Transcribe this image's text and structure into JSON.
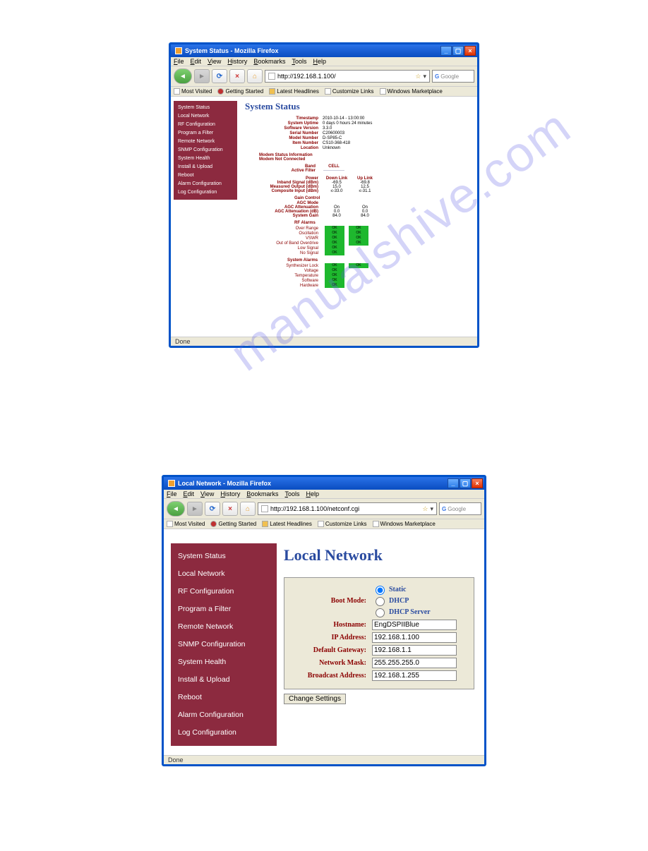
{
  "watermark": "manualshive.com",
  "window1": {
    "title": "System Status - Mozilla Firefox",
    "menu": [
      "File",
      "Edit",
      "View",
      "History",
      "Bookmarks",
      "Tools",
      "Help"
    ],
    "url": "http://192.168.1.100/",
    "search_placeholder": "Google",
    "bookmarks": [
      "Most Visited",
      "Getting Started",
      "Latest Headlines",
      "Customize Links",
      "Windows Marketplace"
    ],
    "status": "Done",
    "sidebar": [
      "System Status",
      "Local Network",
      "RF Configuration",
      "Program a Filter",
      "Remote Network",
      "SNMP Configuration",
      "System Health",
      "Install & Upload",
      "Reboot",
      "Alarm Configuration",
      "Log Configuration"
    ],
    "page_title": "System Status",
    "info": {
      "Timestamp": "2010-10-14 - 13:00:00",
      "System Uptime": "0 days 0 hours 24 minutes",
      "Software Version": "3.3.0",
      "Serial Number": "C20600003",
      "Model Number": "D-SP85-C",
      "Item Number": "CS10-368-418",
      "Location": "Unknown"
    },
    "modem_status_label": "Modem Status Information",
    "modem_status_value": "Modem Not Connected",
    "band_label": "Band",
    "active_filter_label": "Active Filter",
    "band_col": "CELL",
    "power_header": {
      "label": "Power",
      "c1": "Down Link",
      "c2": "Up Link"
    },
    "power_rows": [
      {
        "label": "Inband Signal (dBm)",
        "c1": "-69.5",
        "c2": "-69.8"
      },
      {
        "label": "Measured Output (dBm)",
        "c1": "15.0",
        "c2": "12.5"
      },
      {
        "label": "Composite Input (dBm)",
        "c1": "≤-33.0",
        "c2": "≤-31.1"
      }
    ],
    "gain_header": "Gain Control",
    "gain_rows": [
      {
        "label": "AGC Mode",
        "c1": "",
        "c2": ""
      },
      {
        "label": "AGC Attenuation",
        "c1": "On",
        "c2": "On"
      },
      {
        "label": "AGC Attenuation (dB)",
        "c1": "0.0",
        "c2": "0.0"
      },
      {
        "label": "System Gain",
        "c1": "84.0",
        "c2": "84.0"
      }
    ],
    "rf_alarms_header": "RF Alarms",
    "rf_alarm_rows": [
      {
        "label": "Over Range",
        "c1": "OK",
        "c2": "OK"
      },
      {
        "label": "Oscillation",
        "c1": "OK",
        "c2": "OK"
      },
      {
        "label": "VSWR",
        "c1": "OK",
        "c2": "OK"
      },
      {
        "label": "Out of Band Overdrive",
        "c1": "OK",
        "c2": "OK"
      },
      {
        "label": "Low Signal",
        "c1": "OK",
        "c2": ""
      },
      {
        "label": "No Signal",
        "c1": "OK",
        "c2": ""
      }
    ],
    "sys_alarms_header": "System Alarms",
    "sys_alarm_rows": [
      {
        "label": "Synthesizer Lock",
        "c1": "OK",
        "c2": "OK"
      },
      {
        "label": "Voltage",
        "c1": "OK",
        "c2": ""
      },
      {
        "label": "Temperature",
        "c1": "OK",
        "c2": ""
      },
      {
        "label": "Software",
        "c1": "OK",
        "c2": ""
      },
      {
        "label": "Hardware",
        "c1": "OK",
        "c2": ""
      }
    ]
  },
  "window2": {
    "title": "Local Network - Mozilla Firefox",
    "menu": [
      "File",
      "Edit",
      "View",
      "History",
      "Bookmarks",
      "Tools",
      "Help"
    ],
    "url": "http://192.168.1.100/netconf.cgi",
    "search_placeholder": "Google",
    "bookmarks": [
      "Most Visited",
      "Getting Started",
      "Latest Headlines",
      "Customize Links",
      "Windows Marketplace"
    ],
    "status": "Done",
    "sidebar": [
      "System Status",
      "Local Network",
      "RF Configuration",
      "Program a Filter",
      "Remote Network",
      "SNMP Configuration",
      "System Health",
      "Install & Upload",
      "Reboot",
      "Alarm Configuration",
      "Log Configuration"
    ],
    "page_title": "Local Network",
    "boot_mode_label": "Boot Mode:",
    "boot_mode_options": [
      "Static",
      "DHCP",
      "DHCP Server"
    ],
    "fields": {
      "Hostname:": "EngDSPIIBlue",
      "IP Address:": "192.168.1.100",
      "Default Gateway:": "192.168.1.1",
      "Network Mask:": "255.255.255.0",
      "Broadcast Address:": "192.168.1.255"
    },
    "change_button": "Change Settings"
  }
}
